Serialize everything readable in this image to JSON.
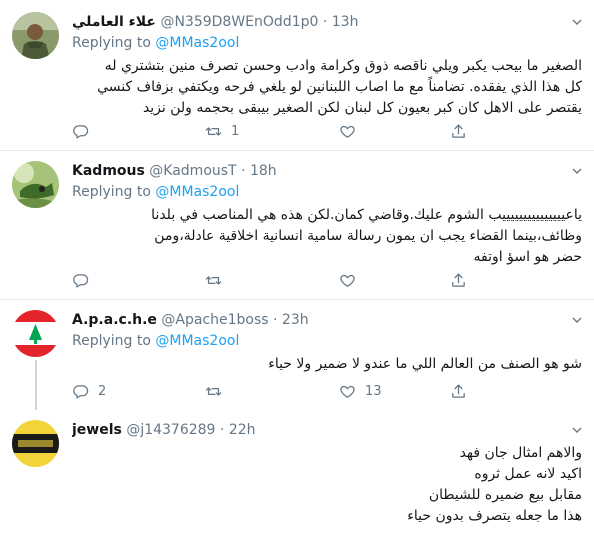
{
  "replying_prefix": "Replying to",
  "tweets": [
    {
      "name": "علاء العاملي",
      "handle": "@N359D8WEnOdd1p0",
      "time": "13h",
      "replying_to": "@MMas2ool",
      "lines": [
        "الصغير ما بيحب يكبر ويلي ناقصه ذوق وكرامة وادب وحسن تصرف منين بتشتري له",
        "كل هذا الذي يفقده. تضامناً مع ما اصاب اللبنانين لو يلغي فرحه ويكتفي بزفاف كنسي",
        "يقتصر على الاهل كان كبر بعيون كل لبنان لكن الصغير بيبقى بحجمه  ولن نزيد"
      ],
      "replies": "",
      "retweets": "1",
      "likes": ""
    },
    {
      "name": "Kadmous",
      "handle": "@KadmousT",
      "time": "18h",
      "replying_to": "@MMas2ool",
      "lines": [
        "ياعيييييييييييييييب الشوم عليك.وقاضي كمان.لكن هذه هي المناصب في بلدنا",
        "وظائف،بينما القضاء يجب ان يمون رسالة سامية انسانية اخلاقية عادلة،ومن",
        "حضر هو اسؤ اوتفه"
      ],
      "replies": "",
      "retweets": "",
      "likes": ""
    },
    {
      "name": "A.p.a.c.h.e",
      "handle": "@Apache1boss",
      "time": "23h",
      "replying_to": "@MMas2ool",
      "lines": [
        "شو هو الصنف من العالم اللي ما عندو لا ضمير ولا حياء"
      ],
      "replies": "2",
      "retweets": "",
      "likes": "13"
    },
    {
      "name": "jewels",
      "handle": "@j14376289",
      "time": "22h",
      "replying_to": "",
      "lines": [
        "والاهم امثال جان فهد",
        "اكيد لانه عمل ثروه",
        "مقابل بيع ضميره للشيطان",
        "هذا ما جعله يتصرف بدون حياء"
      ],
      "replies": "",
      "retweets": "",
      "likes": ""
    }
  ],
  "colors": {
    "text": "#14171a",
    "secondary": "#657786",
    "link": "#1da1f2",
    "separator": "#e6ecf0",
    "thread_line": "#ccd6dd",
    "lebanon_red": "#e3242b",
    "lebanon_green": "#00a651"
  },
  "icons": [
    "chevron-down-icon",
    "reply-icon",
    "retweet-icon",
    "like-icon",
    "share-icon"
  ]
}
